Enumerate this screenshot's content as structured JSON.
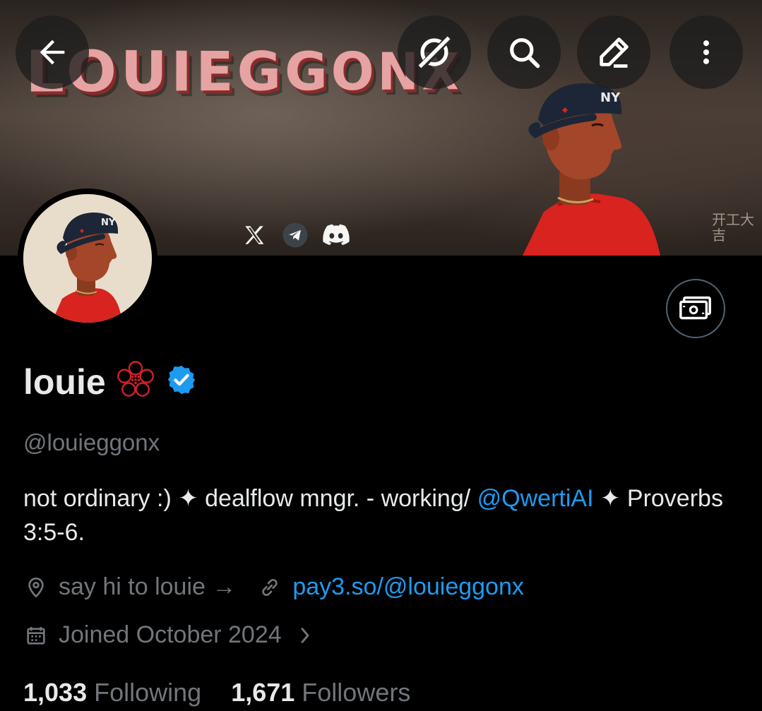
{
  "banner": {
    "title": "LOUIEGGONX",
    "seal_text": "开工大吉",
    "social_icons": [
      "x-logo-icon",
      "telegram-icon",
      "discord-icon"
    ]
  },
  "nav": {
    "back_icon": "arrow-left-icon",
    "grok_icon": "grok-icon",
    "search_icon": "search-icon",
    "compose_icon": "pencil-icon",
    "more_icon": "more-vertical-icon"
  },
  "profile": {
    "display_name": "louie",
    "handle": "@louieggonx",
    "bio_part1": "not ordinary :) ✦ dealflow mngr. - working/ ",
    "bio_mention": "@QwertiAI",
    "bio_part2": " ✦ Proverbs 3:5-6.",
    "location": "say hi to louie →",
    "website": "pay3.so/@louieggonx",
    "joined": "Joined October 2024",
    "following_count": "1,033",
    "following_label": "Following",
    "followers_count": "1,671",
    "followers_label": "Followers"
  },
  "colors": {
    "accent": "#1d9bf0",
    "muted": "#71767b",
    "text": "#e7e9ea",
    "background": "#000000",
    "verified": "#1d9bf0",
    "emblem": "#d0202a"
  }
}
